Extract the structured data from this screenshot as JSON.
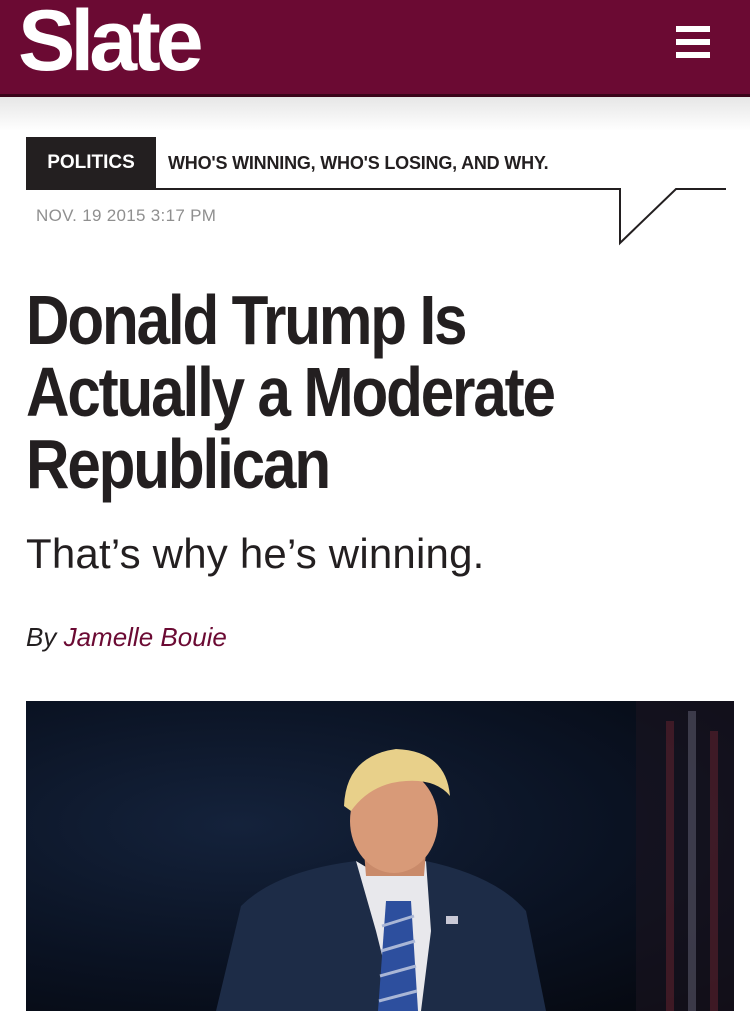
{
  "header": {
    "logo_text": "Slate",
    "menu_icon": "hamburger-menu-icon",
    "brand_color": "#6b0a33"
  },
  "section": {
    "tag": "POLITICS",
    "title": "WHO'S WINNING, WHO'S LOSING, AND WHY."
  },
  "article": {
    "date": "NOV. 19 2015 3:17 PM",
    "headline_lines": [
      "Donald Trump Is",
      "Actually a Moderate",
      "Republican"
    ],
    "dek": "That’s why he’s winning.",
    "byline_prefix": "By",
    "author": "Jamelle Bouie"
  },
  "photo": {
    "subject": "man-in-suit-with-blue-striped-tie",
    "background_color": "#0a1222",
    "suit_color": "#1d2c47",
    "tie_color": "#2d4f9e"
  }
}
